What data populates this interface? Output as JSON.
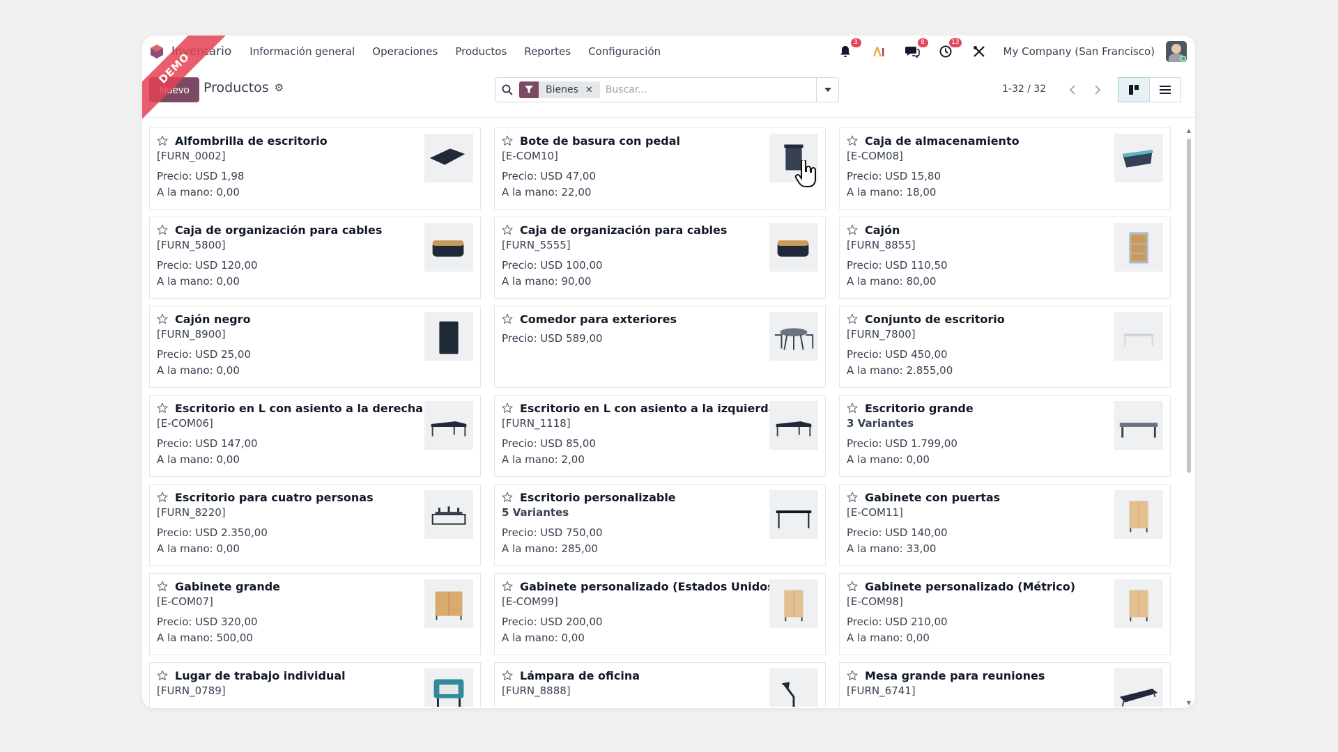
{
  "navbar": {
    "app_name": "Inventario",
    "menu": [
      "Información general",
      "Operaciones",
      "Productos",
      "Reportes",
      "Configuración"
    ],
    "notifications": {
      "activity_count": "3",
      "messages_count": "8",
      "clock_count": "13"
    },
    "company": "My Company (San Francisco)"
  },
  "ribbon": "DEMO",
  "control_panel": {
    "new_label": "Nuevo",
    "breadcrumb": "Productos",
    "facet_label": "Bienes",
    "search_placeholder": "Buscar...",
    "pager": "1-32 / 32"
  },
  "colors": {
    "brand": "#7c4a64",
    "badge": "#e4475c",
    "accent": "#017e84"
  },
  "products": [
    {
      "name": "Alfombrilla de escritorio",
      "code": "[FURN_0002]",
      "price": "Precio: USD 1,98",
      "stock": "A la mano: 0,00",
      "icon": "desk-pad"
    },
    {
      "name": "Bote de basura con pedal",
      "code": "[E-COM10]",
      "price": "Precio: USD 47,00",
      "stock": "A la mano: 22,00",
      "icon": "trash-bin"
    },
    {
      "name": "Caja de almacenamiento",
      "code": "[E-COM08]",
      "price": "Precio: USD 15,80",
      "stock": "A la mano: 18,00",
      "icon": "storage-box"
    },
    {
      "name": "Caja de organización para cables",
      "code": "[FURN_5800]",
      "price": "Precio: USD 120,00",
      "stock": "A la mano: 0,00",
      "icon": "cable-box"
    },
    {
      "name": "Caja de organización para cables",
      "code": "[FURN_5555]",
      "price": "Precio: USD 100,00",
      "stock": "A la mano: 90,00",
      "icon": "cable-box"
    },
    {
      "name": "Cajón",
      "code": "[FURN_8855]",
      "price": "Precio: USD 110,50",
      "stock": "A la mano: 80,00",
      "icon": "drawer-unit"
    },
    {
      "name": "Cajón negro",
      "code": "[FURN_8900]",
      "price": "Precio: USD 25,00",
      "stock": "A la mano: 0,00",
      "icon": "black-drawer"
    },
    {
      "name": "Comedor para exteriores",
      "code": "",
      "price": "Precio: USD 589,00",
      "stock": "",
      "icon": "outdoor-dining"
    },
    {
      "name": "Conjunto de escritorio",
      "code": "[FURN_7800]",
      "price": "Precio: USD 450,00",
      "stock": "A la mano: 2.855,00",
      "icon": "desk-set"
    },
    {
      "name": "Escritorio en L con asiento a la derecha",
      "code": "[E-COM06]",
      "price": "Precio: USD 147,00",
      "stock": "A la mano: 0,00",
      "icon": "l-desk"
    },
    {
      "name": "Escritorio en L con asiento a la izquierda",
      "code": "[FURN_1118]",
      "price": "Precio: USD 85,00",
      "stock": "A la mano: 2,00",
      "icon": "l-desk"
    },
    {
      "name": "Escritorio grande",
      "code": "3 Variantes",
      "price": "Precio: USD 1.799,00",
      "stock": "A la mano: 0,00",
      "icon": "large-desk",
      "code_bold": true
    },
    {
      "name": "Escritorio para cuatro personas",
      "code": "[FURN_8220]",
      "price": "Precio: USD 2.350,00",
      "stock": "A la mano: 0,00",
      "icon": "four-desk"
    },
    {
      "name": "Escritorio personalizable",
      "code": "5 Variantes",
      "price": "Precio: USD 750,00",
      "stock": "A la mano: 285,00",
      "icon": "custom-desk",
      "code_bold": true
    },
    {
      "name": "Gabinete con puertas",
      "code": "[E-COM11]",
      "price": "Precio: USD 140,00",
      "stock": "A la mano: 33,00",
      "icon": "cabinet"
    },
    {
      "name": "Gabinete grande",
      "code": "[E-COM07]",
      "price": "Precio: USD 320,00",
      "stock": "A la mano: 500,00",
      "icon": "large-cabinet"
    },
    {
      "name": "Gabinete personalizado (Estados Unidos)",
      "code": "[E-COM99]",
      "price": "Precio: USD 200,00",
      "stock": "A la mano: 0,00",
      "icon": "cabinet"
    },
    {
      "name": "Gabinete personalizado (Métrico)",
      "code": "[E-COM98]",
      "price": "Precio: USD 210,00",
      "stock": "A la mano: 0,00",
      "icon": "cabinet"
    },
    {
      "name": "Lugar de trabajo individual",
      "code": "[FURN_0789]",
      "price": "",
      "stock": "",
      "icon": "workstation"
    },
    {
      "name": "Lámpara de oficina",
      "code": "[FURN_8888]",
      "price": "",
      "stock": "",
      "icon": "office-lamp"
    },
    {
      "name": "Mesa grande para reuniones",
      "code": "[FURN_6741]",
      "price": "",
      "stock": "",
      "icon": "meeting-table"
    }
  ]
}
